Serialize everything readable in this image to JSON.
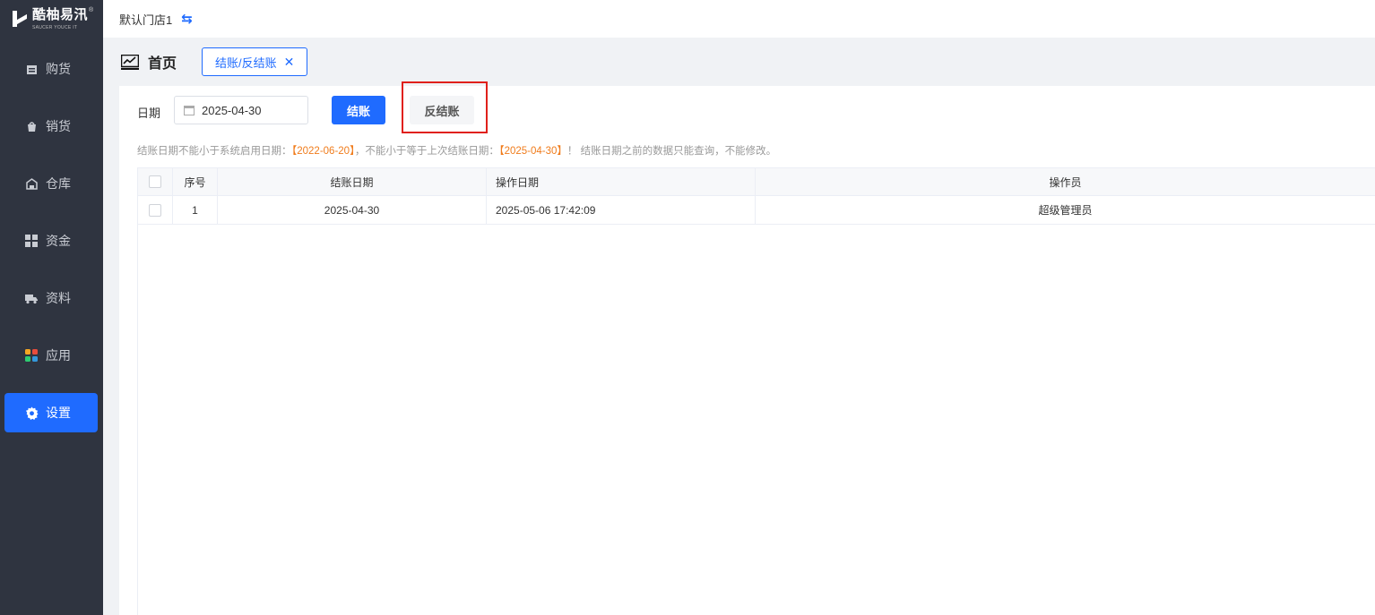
{
  "brand": {
    "name": "酷柚易汛",
    "sub": "SAUCER YOUCE IT",
    "reg": "®"
  },
  "store": {
    "name": "默认门店1",
    "switch_icon": "swap-arrows-icon"
  },
  "sidebar": {
    "items": [
      {
        "label": "购货",
        "icon": "purchase-icon"
      },
      {
        "label": "销货",
        "icon": "sales-icon"
      },
      {
        "label": "仓库",
        "icon": "warehouse-icon"
      },
      {
        "label": "资金",
        "icon": "fund-grid-icon"
      },
      {
        "label": "资料",
        "icon": "truck-icon"
      },
      {
        "label": "应用",
        "icon": "apps-icon"
      },
      {
        "label": "设置",
        "icon": "gear-icon",
        "active": true
      }
    ]
  },
  "tabs": {
    "home": "首页",
    "current": "结账/反结账",
    "close": "✕"
  },
  "filter": {
    "date_label": "日期",
    "date_value": "2025-04-30"
  },
  "actions": {
    "settle": "结账",
    "unsettle": "反结账"
  },
  "notice": {
    "part1": "结账日期不能小于系统启用日期：",
    "date1": "【2022-06-20】",
    "part2": "，不能小于等于上次结账日期：",
    "date2": "【2025-04-30】",
    "part3": "！ 结账日期之前的数据只能查询，不能修改。"
  },
  "table": {
    "columns": [
      "序号",
      "结账日期",
      "操作日期",
      "操作员"
    ],
    "rows": [
      {
        "no": "1",
        "settle_date": "2025-04-30",
        "op_date": "2025-05-06 17:42:09",
        "operator": "超级管理员"
      }
    ]
  },
  "colors": {
    "accent": "#1f6bff",
    "sidebar": "#2f3440",
    "highlight": "#e0201b",
    "warn": "#f07c1c"
  }
}
